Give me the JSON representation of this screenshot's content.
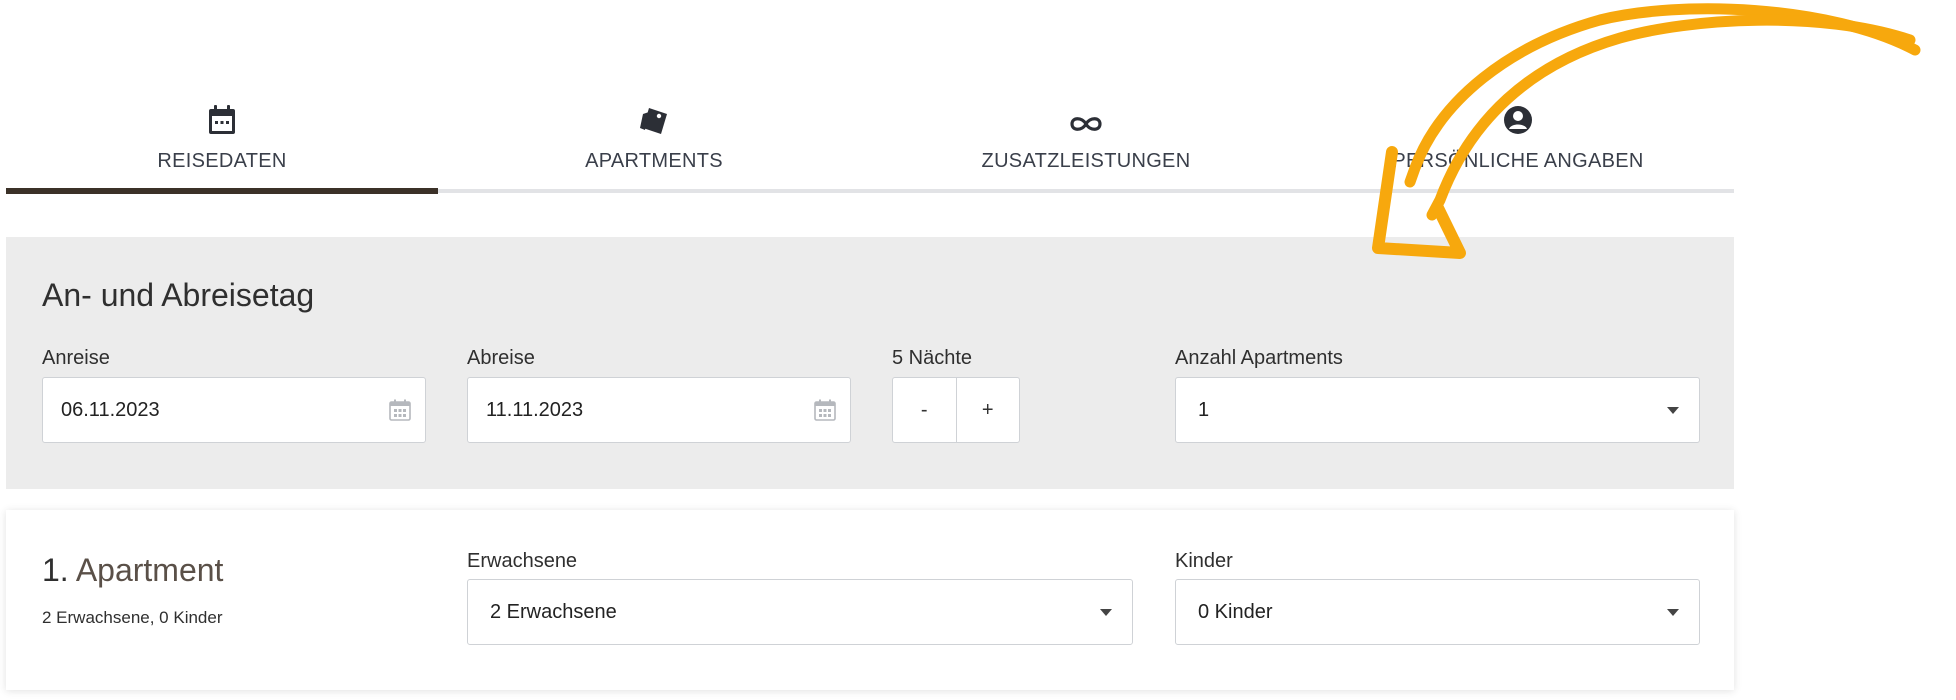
{
  "steps": [
    {
      "label": "REISEDATEN",
      "icon": "calendar-icon",
      "active": true
    },
    {
      "label": "APARTMENTS",
      "icon": "tags-icon",
      "active": false
    },
    {
      "label": "ZUSATZLEISTUNGEN",
      "icon": "infinity-icon",
      "active": false
    },
    {
      "label": "PERSÖNLICHE ANGABEN",
      "icon": "user-circle-icon",
      "active": false
    }
  ],
  "dates": {
    "title": "An- und Abreisetag",
    "arrival_label": "Anreise",
    "arrival_value": "06.11.2023",
    "departure_label": "Abreise",
    "departure_value": "11.11.2023",
    "nights_label": "5 Nächte",
    "minus_label": "-",
    "plus_label": "+",
    "apartments_label": "Anzahl Apartments",
    "apartments_value": "1"
  },
  "apartment": {
    "number": "1.",
    "title": "Apartment",
    "summary": "2 Erwachsene, 0 Kinder",
    "adults_label": "Erwachsene",
    "adults_value": "2 Erwachsene",
    "children_label": "Kinder",
    "children_value": "0 Kinder"
  },
  "colors": {
    "active_tab": "#3b3128",
    "annotation_arrow": "#f7a80d",
    "panel_bg": "#ececec"
  }
}
